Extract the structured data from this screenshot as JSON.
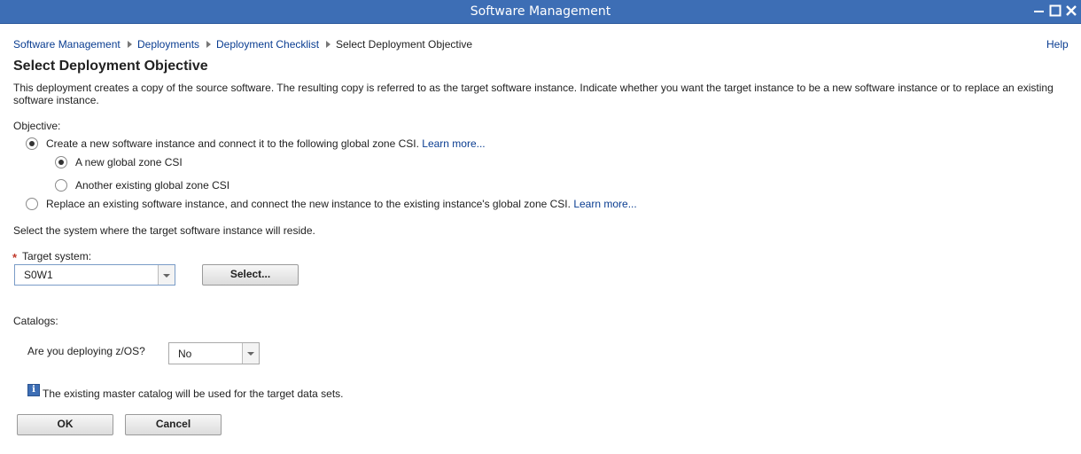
{
  "window": {
    "title": "Software Management",
    "controls": [
      "minimize-icon",
      "maximize-icon",
      "close-icon"
    ]
  },
  "breadcrumb": [
    {
      "label": "Software Management"
    },
    {
      "label": "Deployments"
    },
    {
      "label": "Deployment Checklist"
    },
    {
      "label": "Select Deployment Objective"
    }
  ],
  "help_label": "Help",
  "page_title": "Select Deployment Objective",
  "description": "This deployment creates a copy of the source software. The resulting copy is referred to as the target software instance. Indicate whether you want the target instance to be a new software instance or to replace an existing software instance.",
  "objective": {
    "label": "Objective:",
    "option_new": {
      "label": "Create a new software instance and connect it to the following global zone CSI.",
      "link": "Learn more...",
      "selected": true
    },
    "sub_new_csi": {
      "label": "A new global zone CSI",
      "selected": true
    },
    "sub_existing_csi": {
      "label": "Another existing global zone CSI",
      "selected": false
    },
    "option_replace": {
      "label": "Replace an existing software instance, and connect the new instance to the existing instance's global zone CSI.",
      "link": "Learn more...",
      "selected": false
    }
  },
  "target": {
    "instruction": "Select the system where the target software instance will reside.",
    "required_mark": "*",
    "label": "Target system:",
    "value": "S0W1",
    "select_button": "Select..."
  },
  "catalogs": {
    "label": "Catalogs:",
    "question": "Are you deploying z/OS?",
    "value": "No",
    "info_text": "The existing master catalog will be used for the target data sets."
  },
  "buttons": {
    "ok": "OK",
    "cancel": "Cancel"
  },
  "colors": {
    "titlebar": "#3d6eb5",
    "link": "#0a3d91",
    "required": "#c0392b"
  }
}
